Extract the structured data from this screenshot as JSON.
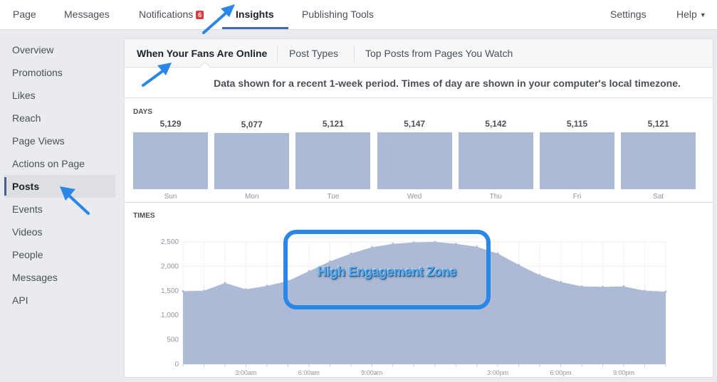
{
  "topnav": {
    "items": [
      {
        "label": "Page"
      },
      {
        "label": "Messages"
      },
      {
        "label": "Notifications",
        "badge": "6"
      },
      {
        "label": "Insights",
        "active": true
      },
      {
        "label": "Publishing Tools"
      }
    ],
    "right": [
      {
        "label": "Settings"
      },
      {
        "label": "Help"
      }
    ]
  },
  "sidebar": {
    "items": [
      {
        "label": "Overview"
      },
      {
        "label": "Promotions"
      },
      {
        "label": "Likes"
      },
      {
        "label": "Reach"
      },
      {
        "label": "Page Views"
      },
      {
        "label": "Actions on Page"
      },
      {
        "label": "Posts",
        "active": true
      },
      {
        "label": "Events"
      },
      {
        "label": "Videos"
      },
      {
        "label": "People"
      },
      {
        "label": "Messages"
      },
      {
        "label": "API"
      }
    ]
  },
  "subtabs": [
    {
      "label": "When Your Fans Are Online",
      "active": true
    },
    {
      "label": "Post Types"
    },
    {
      "label": "Top Posts from Pages You Watch"
    }
  ],
  "notice": "Data shown for a recent 1-week period. Times of day are shown in your computer's local timezone.",
  "annotation": "High Engagement Zone",
  "colors": {
    "bar_fill": "#adbad6",
    "area_fill": "#adbad6",
    "annotation_blue": "#2a87e8",
    "active_accent": "#4267b2",
    "badge_red": "#e0393e"
  },
  "chart_data": [
    {
      "type": "bar",
      "title": "DAYS",
      "categories": [
        "Sun",
        "Mon",
        "Tue",
        "Wed",
        "Thu",
        "Fri",
        "Sat"
      ],
      "values": [
        5129,
        5077,
        5121,
        5147,
        5142,
        5115,
        5121
      ],
      "value_labels": [
        "5,129",
        "5,077",
        "5,121",
        "5,147",
        "5,142",
        "5,115",
        "5,121"
      ]
    },
    {
      "type": "area",
      "title": "TIMES",
      "xlabel": "",
      "ylabel": "",
      "x": [
        "12:00am",
        "1:00am",
        "2:00am",
        "3:00am",
        "4:00am",
        "5:00am",
        "6:00am",
        "7:00am",
        "8:00am",
        "9:00am",
        "10:00am",
        "11:00am",
        "12:00pm",
        "1:00pm",
        "2:00pm",
        "3:00pm",
        "4:00pm",
        "5:00pm",
        "6:00pm",
        "7:00pm",
        "8:00pm",
        "9:00pm",
        "10:00pm",
        "11:00pm"
      ],
      "values": [
        1490,
        1500,
        1660,
        1530,
        1600,
        1700,
        1900,
        2100,
        2260,
        2390,
        2460,
        2490,
        2500,
        2460,
        2400,
        2260,
        2030,
        1820,
        1680,
        1590,
        1580,
        1590,
        1500,
        1480
      ],
      "ylim": [
        0,
        2500
      ],
      "yticks": [
        0,
        500,
        1000,
        1500,
        2000,
        2500
      ],
      "ytick_labels": [
        "0",
        "500",
        "1,000",
        "1,500",
        "2,000",
        "2,500"
      ],
      "xtick_labels": [
        {
          "index": 3,
          "label": "3:00am"
        },
        {
          "index": 6,
          "label": "6:00am"
        },
        {
          "index": 9,
          "label": "9:00am"
        },
        {
          "index": 15,
          "label": "3:00pm"
        },
        {
          "index": 18,
          "label": "6:00pm"
        },
        {
          "index": 21,
          "label": "9:00pm"
        }
      ],
      "grid": true,
      "annotation": {
        "text": "High Engagement Zone",
        "x_range": [
          "6:00am",
          "2:00pm"
        ]
      }
    }
  ]
}
